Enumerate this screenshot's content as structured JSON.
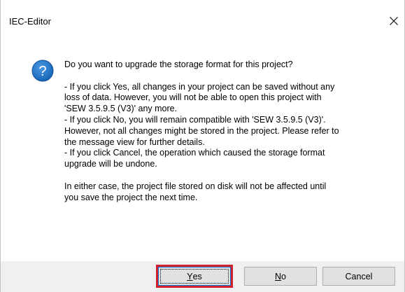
{
  "window": {
    "title": "IEC-Editor",
    "close_icon": "close-icon"
  },
  "dialog": {
    "icon": "question-icon",
    "icon_color": "#1f6fbf",
    "message_lines": [
      "Do you want to upgrade the storage format for this project?",
      "",
      "- If you click Yes, all changes in your project can be saved without any",
      "loss of data. However, you will not be able to open this project with",
      "'SEW 3.5.9.5 (V3)' any more.",
      "- If you click No, you will remain compatible with 'SEW 3.5.9.5 (V3)'.",
      "However, not all changes might be stored in the project. Please refer to",
      "the message view for further details.",
      "- If you click Cancel, the operation which caused the storage format",
      "upgrade will be undone.",
      "",
      "In either case, the project file stored on disk will not be affected until",
      "you save the project the next time."
    ]
  },
  "buttons": {
    "yes": {
      "mnemonic": "Y",
      "rest": "es"
    },
    "no": {
      "mnemonic": "N",
      "rest": "o"
    },
    "cancel": {
      "label": "Cancel"
    }
  },
  "colors": {
    "highlight": "#d3202a",
    "footer_bg": "#f0f0f0",
    "default_button_border": "#0078d7"
  }
}
